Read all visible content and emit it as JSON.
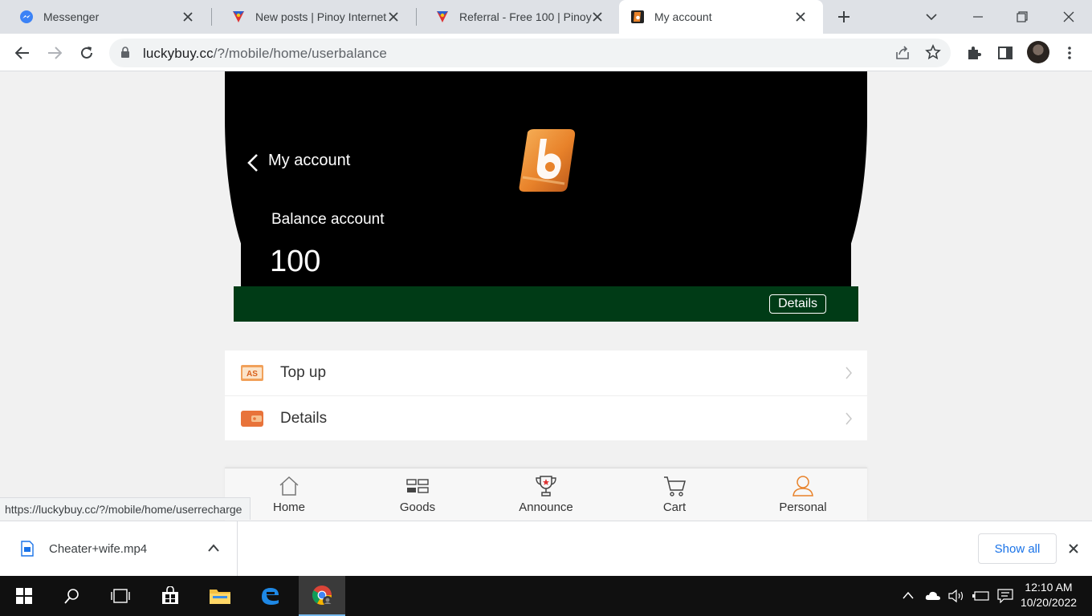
{
  "browser": {
    "tabs": [
      {
        "title": "Messenger",
        "icon": "messenger-icon",
        "active": false
      },
      {
        "title": "New posts | Pinoy Internet",
        "icon": "pinoy-internet-icon",
        "active": false
      },
      {
        "title": "Referral - Free 100 | Pinoy",
        "icon": "pinoy-internet-icon",
        "active": false
      },
      {
        "title": "My account",
        "icon": "luckybuy-icon",
        "active": true
      }
    ],
    "url_host": "luckybuy.cc",
    "url_path": "/?/mobile/home/userbalance",
    "status_link": "https://luckybuy.cc/?/mobile/home/userrecharge"
  },
  "page": {
    "header_title": "My account",
    "balance_label": "Balance account",
    "balance_value": "100",
    "details_button": "Details",
    "menu": [
      {
        "label": "Top up",
        "icon": "top-up-icon"
      },
      {
        "label": "Details",
        "icon": "wallet-icon"
      }
    ],
    "bottom_nav": [
      {
        "label": "Home",
        "icon": "home-icon"
      },
      {
        "label": "Goods",
        "icon": "goods-icon"
      },
      {
        "label": "Announce",
        "icon": "trophy-icon"
      },
      {
        "label": "Cart",
        "icon": "cart-icon"
      },
      {
        "label": "Personal",
        "icon": "person-icon"
      }
    ],
    "colors": {
      "header_bg": "#000000",
      "bar_bg": "#003b16",
      "accent_orange": "#e8822a"
    }
  },
  "downloads": {
    "file_name": "Cheater+wife.mp4",
    "show_all": "Show all"
  },
  "taskbar": {
    "time": "12:10 AM",
    "date": "10/20/2022"
  }
}
